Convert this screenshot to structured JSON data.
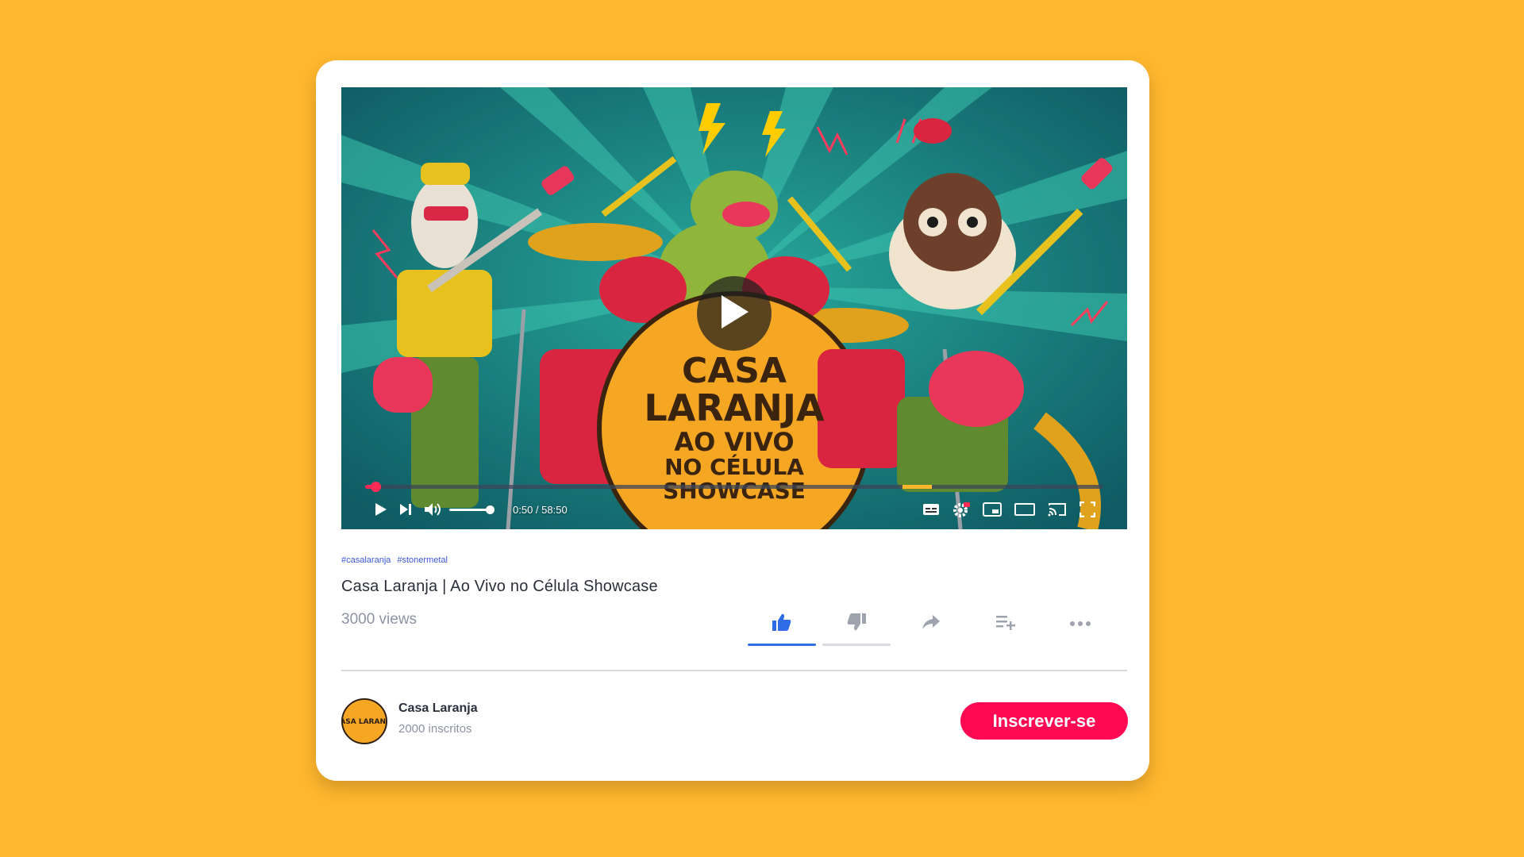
{
  "video": {
    "time_display": "0:50 / 58:50",
    "progress_fraction": 0.014,
    "volume_fraction": 1.0,
    "controls": [
      "play-icon",
      "next-icon",
      "volume-icon",
      "subtitles-icon",
      "settings-hd-icon",
      "miniplayer-icon",
      "theater-icon",
      "cast-icon",
      "fullscreen-icon"
    ],
    "thumbnail_text": [
      "CASA",
      "LARANJA",
      "AO VIVO",
      "NO CÉLULA",
      "SHOWCASE"
    ]
  },
  "tags": [
    "#casalaranja",
    "#stonermetal"
  ],
  "title": "Casa Laranja | Ao Vivo no Célula Showcase",
  "views": "3000 views",
  "actions": [
    {
      "name": "like",
      "icon": "thumbs-up-icon",
      "active": true
    },
    {
      "name": "dislike",
      "icon": "thumbs-down-icon",
      "active": false
    },
    {
      "name": "share",
      "icon": "share-icon",
      "active": false
    },
    {
      "name": "add-to-playlist",
      "icon": "playlist-add-icon",
      "active": false
    },
    {
      "name": "more",
      "icon": "more-icon",
      "active": false
    }
  ],
  "channel": {
    "name": "Casa Laranja",
    "subscribers": "2000 inscritos",
    "avatar_text": "CASA LARANJA"
  },
  "subscribe_label": "Inscrever-se",
  "colors": {
    "background": "#FFB72E",
    "accent": "#FF0A52",
    "like_active": "#2f6ce5",
    "progress": "#ff2a55"
  }
}
